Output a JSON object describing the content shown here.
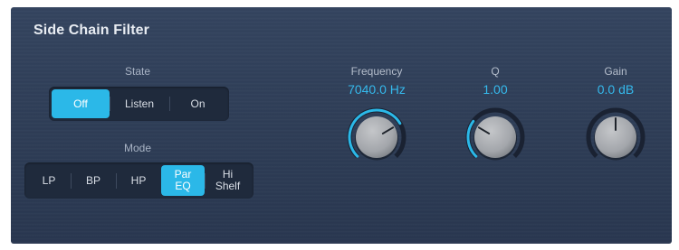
{
  "panel": {
    "title": "Side Chain Filter"
  },
  "state": {
    "label": "State",
    "options": [
      "Off",
      "Listen",
      "On"
    ],
    "selected": "Off"
  },
  "mode": {
    "label": "Mode",
    "options": [
      "LP",
      "BP",
      "HP",
      "Par EQ",
      "Hi Shelf"
    ],
    "selected": "Par EQ"
  },
  "knobs": {
    "frequency": {
      "label": "Frequency",
      "value_text": "7040.0 Hz",
      "level": 0.72
    },
    "q": {
      "label": "Q",
      "value_text": "1.00",
      "level": 0.28
    },
    "gain": {
      "label": "Gain",
      "value_text": "0.0 dB",
      "level": 0.5
    }
  },
  "colors": {
    "accent": "#2bb8e8",
    "panel_bg": "#2f3e57",
    "knob_track": "#1a2232"
  }
}
